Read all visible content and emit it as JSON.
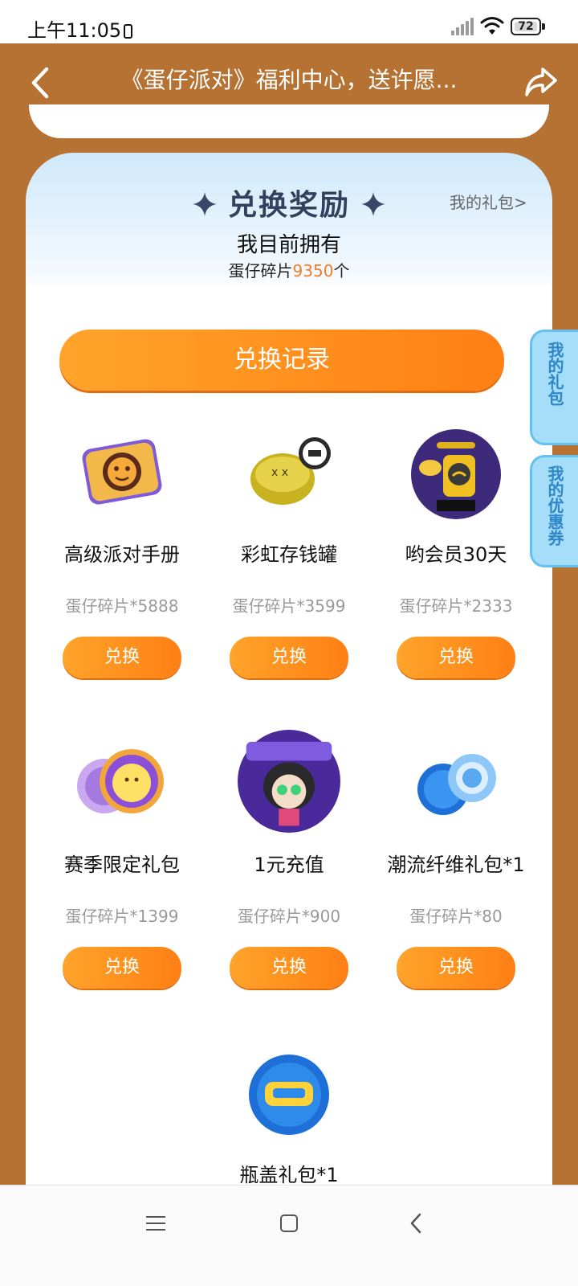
{
  "status_bar": {
    "time": "上午11:05",
    "battery": "72"
  },
  "nav": {
    "title": "《蛋仔派对》福利中心，送许愿..."
  },
  "section": {
    "title": "兑换奖励",
    "my_gift_link": "我的礼包>",
    "owned_label": "我目前拥有",
    "owned_prefix": "蛋仔碎片",
    "owned_count": "9350",
    "owned_suffix": "个",
    "record_button": "兑换记录"
  },
  "items": [
    {
      "name": "高级派对手册",
      "price": "蛋仔碎片*5888",
      "button": "兑换",
      "icon": "party-handbook-icon"
    },
    {
      "name": "彩虹存钱罐",
      "price": "蛋仔碎片*3599",
      "button": "兑换",
      "icon": "piggy-bank-icon"
    },
    {
      "name": "哟会员30天",
      "price": "蛋仔碎片*2333",
      "button": "兑换",
      "icon": "vip-membership-icon"
    },
    {
      "name": "赛季限定礼包",
      "price": "蛋仔碎片*1399",
      "button": "兑换",
      "icon": "season-pack-icon"
    },
    {
      "name": "1元充值",
      "price": "蛋仔碎片*900",
      "button": "兑换",
      "icon": "recharge-icon"
    },
    {
      "name": "潮流纤维礼包*1",
      "price": "蛋仔碎片*80",
      "button": "兑换",
      "icon": "fiber-pack-icon"
    },
    {
      "name": "瓶盖礼包*1",
      "price": "",
      "button": "",
      "icon": "bottle-cap-icon"
    }
  ],
  "side_tabs": [
    {
      "label": "我的礼包"
    },
    {
      "label": "我的优惠券"
    }
  ],
  "colors": {
    "background": "#b57232",
    "accent": "#ff8c1a",
    "price_highlight": "#f07d2a",
    "side_tab": "#a6ddf9"
  }
}
